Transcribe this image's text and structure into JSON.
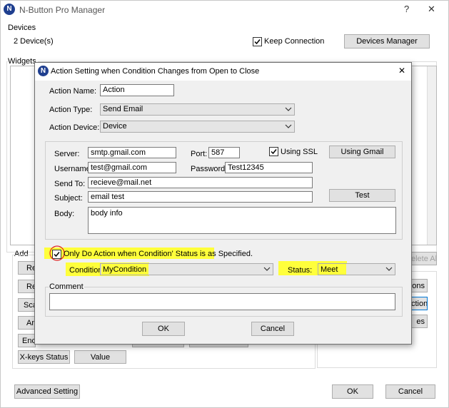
{
  "main_window": {
    "title": "N-Button Pro Manager",
    "help_glyph": "?",
    "close_glyph": "✕",
    "devices_group_label": "Devices",
    "device_count": "2 Device(s)",
    "keep_connection_label": "Keep Connection",
    "keep_connection_checked": true,
    "devices_manager_button": "Devices Manager",
    "widgets_group_label": "Widgets",
    "add_group_label": "Add",
    "left_button_fragments": [
      "Re",
      "Re",
      "Sca",
      "An",
      "Enc"
    ],
    "xkeys_status_button": "X-keys Status",
    "value_button": "Value",
    "delete_all_fragment": "elete All",
    "right_fragments": [
      "ons",
      "ction",
      "es"
    ],
    "advanced_setting_button": "Advanced Setting",
    "ok_button": "OK",
    "cancel_button": "Cancel"
  },
  "dialog": {
    "title": "Action Setting when Condition Changes from Open to Close",
    "close_glyph": "✕",
    "action_name_label": "Action Name:",
    "action_name_value": "Action",
    "action_type_label": "Action Type:",
    "action_type_value": "Send Email",
    "action_device_label": "Action Device:",
    "action_device_value": "Device",
    "email": {
      "server_label": "Server:",
      "server_value": "smtp.gmail.com",
      "port_label": "Port:",
      "port_value": "587",
      "using_ssl_label": "Using SSL",
      "using_ssl_checked": true,
      "using_gmail_button": "Using Gmail",
      "username_label": "Username:",
      "username_value": "test@gmail.com",
      "password_label": "Password:",
      "password_value": "Test12345",
      "send_to_label": "Send To:",
      "send_to_value": "recieve@mail.net",
      "subject_label": "Subject:",
      "subject_value": "email test",
      "test_button": "Test",
      "body_label": "Body:",
      "body_value": "body info"
    },
    "only_do_action_label": "Only Do Action when Condition' Status is as Specified.",
    "only_do_action_checked": true,
    "condition_label": "Condition:",
    "condition_value": "MyCondition",
    "status_label": "Status:",
    "status_value": "Meet",
    "comment_label": "Comment",
    "comment_value": "",
    "ok_button": "OK",
    "cancel_button": "Cancel"
  },
  "colors": {
    "highlight": "#ffff3b",
    "annotation_circle": "#e02020",
    "app_icon": "#1f3f8f"
  }
}
